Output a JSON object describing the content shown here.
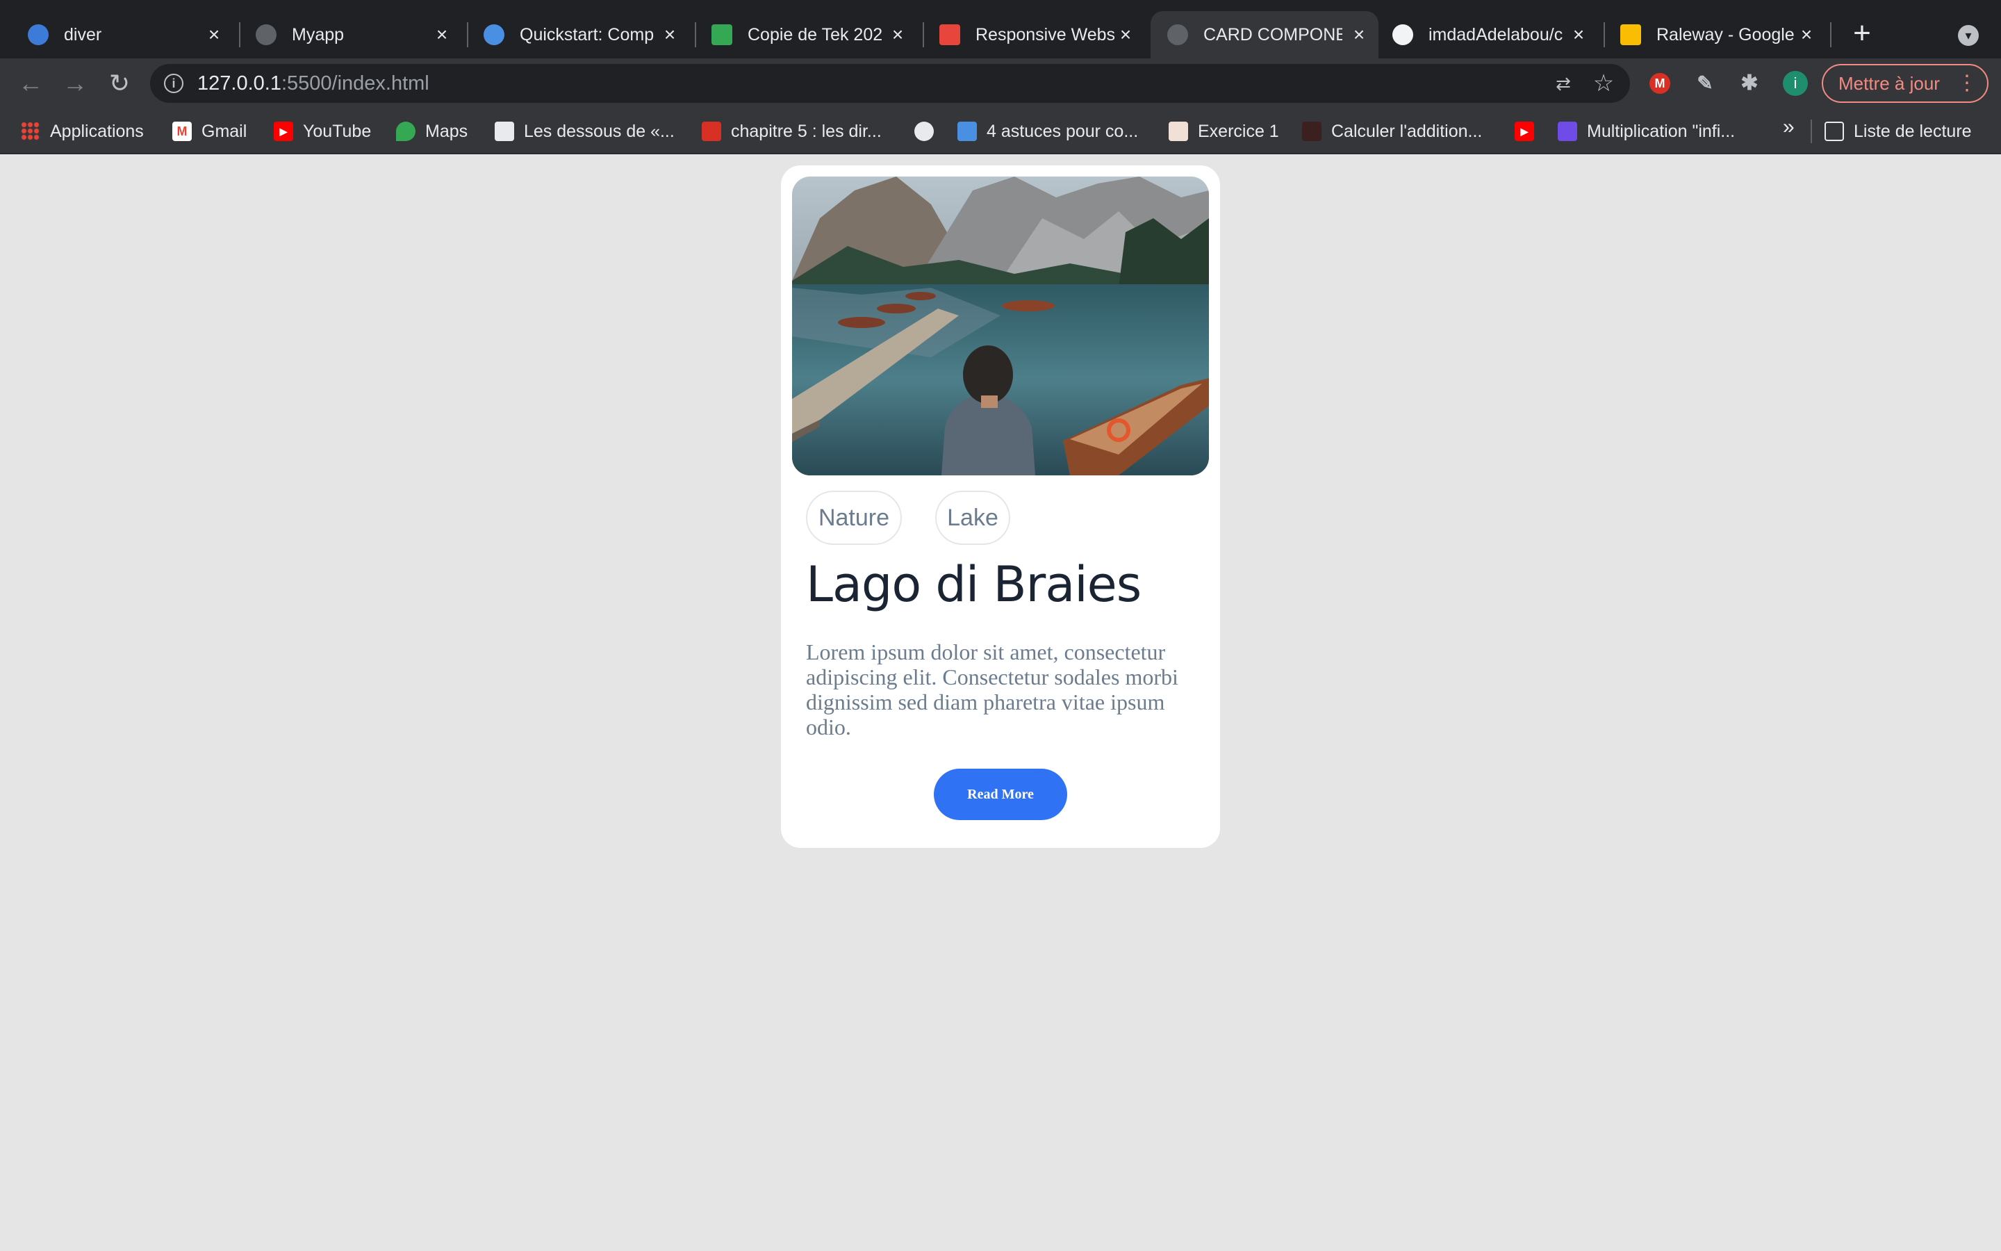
{
  "browser": {
    "tabs": [
      {
        "title": "diver",
        "active": false
      },
      {
        "title": "Myapp",
        "active": false
      },
      {
        "title": "Quickstart: Comp",
        "active": false
      },
      {
        "title": "Copie de Tek 202",
        "active": false
      },
      {
        "title": "Responsive Webs",
        "active": false
      },
      {
        "title": "CARD COMPONE",
        "active": true
      },
      {
        "title": "imdadAdelabou/c",
        "active": false
      },
      {
        "title": "Raleway - Google",
        "active": false
      }
    ],
    "new_tab": "+",
    "tab_close": "×",
    "url_host": "127.0.0.1",
    "url_rest": ":5500/index.html",
    "update_label": "Mettre à jour",
    "profile_initial": "i",
    "bookmarks": [
      "Applications",
      "Gmail",
      "YouTube",
      "Maps",
      "Les dessous de «...",
      "chapitre 5 : les dir...",
      "4 astuces pour co...",
      "Exercice 1",
      "Calculer l'addition...",
      "Multiplication \"infi..."
    ],
    "bookmarks_overflow": "»",
    "reading_list": "Liste de lecture"
  },
  "card": {
    "tags": [
      "Nature",
      "Lake"
    ],
    "title": "Lago di Braies",
    "description": "Lorem ipsum dolor sit amet, consectetur adipiscing elit. Consectetur sodales morbi dignissim sed diam pharetra vitae ipsum odio.",
    "button_label": "Read More"
  },
  "colors": {
    "page_bg": "#e5e5e5",
    "button": "#2f72f4",
    "title": "#1a2433",
    "muted_text": "#6b7c8f"
  }
}
